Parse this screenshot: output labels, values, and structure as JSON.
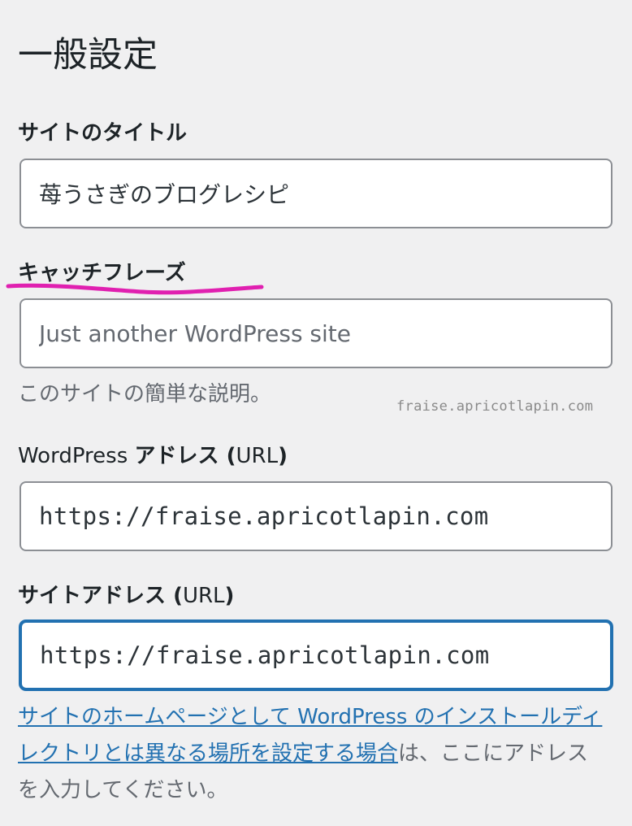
{
  "page": {
    "title": "一般設定"
  },
  "site_title": {
    "label": "サイトのタイトル",
    "value": "苺うさぎのブログレシピ"
  },
  "tagline": {
    "label": "キャッチフレーズ",
    "placeholder": "Just another WordPress site",
    "value": "",
    "description": "このサイトの簡単な説明。"
  },
  "wordpress_address": {
    "label_prefix": "WordPress ",
    "label_bold": "アドレス",
    "label_paren_open": " (",
    "label_url": "URL",
    "label_paren_close": ")",
    "value": "https://fraise.apricotlapin.com"
  },
  "site_address": {
    "label_bold": "サイトアドレス",
    "label_paren_open": " (",
    "label_url": "URL",
    "label_paren_close": ")",
    "value": "https://fraise.apricotlapin.com",
    "description_link": "サイトのホームページとして WordPress のインストールディレクトリとは異なる場所を設定する場合",
    "description_rest": "は、ここにアドレスを入力してください。"
  },
  "watermark": "fraise.apricotlapin.com",
  "colors": {
    "accent": "#2271b1",
    "highlight_mark": "#e020b0",
    "text": "#1d2327",
    "muted": "#646970"
  }
}
